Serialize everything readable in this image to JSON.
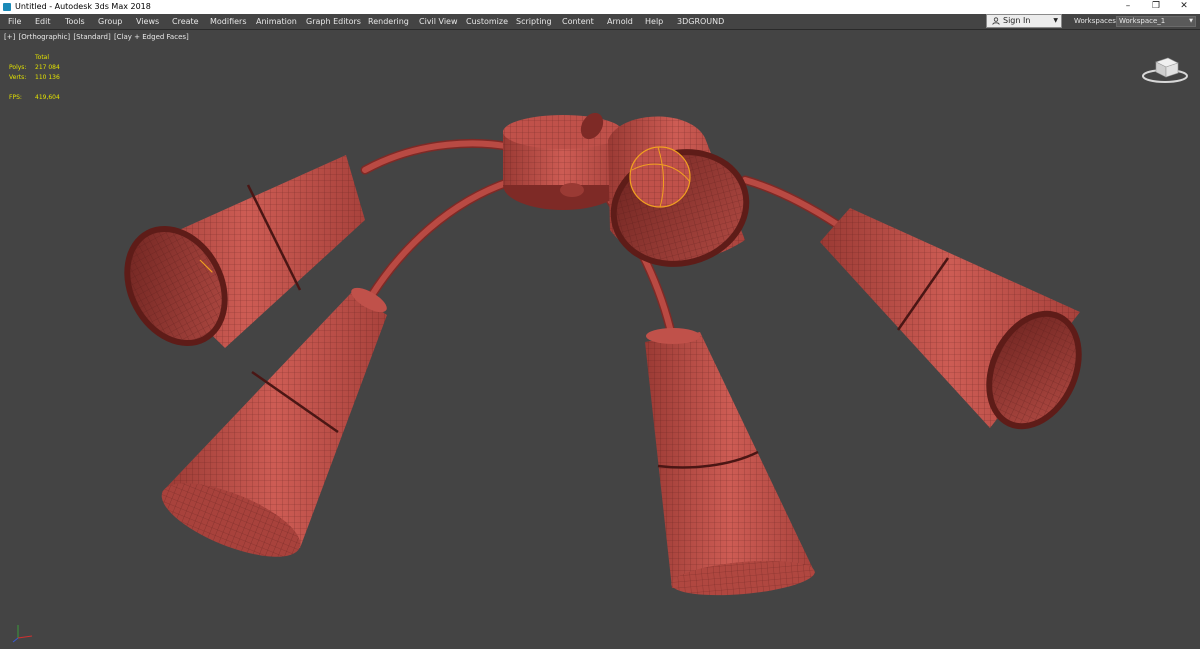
{
  "window": {
    "title": "Untitled - Autodesk 3ds Max 2018",
    "controls": [
      "–",
      "❐",
      "✕"
    ]
  },
  "menu": [
    "File",
    "Edit",
    "Tools",
    "Group",
    "Views",
    "Create",
    "Modifiers",
    "Animation",
    "Graph Editors",
    "Rendering",
    "Civil View",
    "Customize",
    "Scripting",
    "Content",
    "Arnold",
    "Help",
    "3DGROUND"
  ],
  "signin": {
    "label": "Sign In",
    "icon": "user-icon"
  },
  "workspaces": {
    "label": "Workspaces:",
    "value": "Workspace_1"
  },
  "viewport": {
    "labels": [
      "[+]",
      "[Orthographic]",
      "[Standard]",
      "[Clay + Edged Faces]"
    ],
    "stats": {
      "header": "Total",
      "rows": [
        {
          "k": "Polys:",
          "v": "217 084"
        },
        {
          "k": "Verts:",
          "v": "110 136"
        }
      ],
      "fps_k": "FPS:",
      "fps_v": "419,604"
    }
  },
  "colors": {
    "viewport_bg": "#444444",
    "clay": "#b94a43",
    "clay_light": "#d0625a",
    "clay_dark": "#7e2a26",
    "wire": "#4a1614",
    "stats": "#e2e200",
    "selection": "#f0a020"
  }
}
